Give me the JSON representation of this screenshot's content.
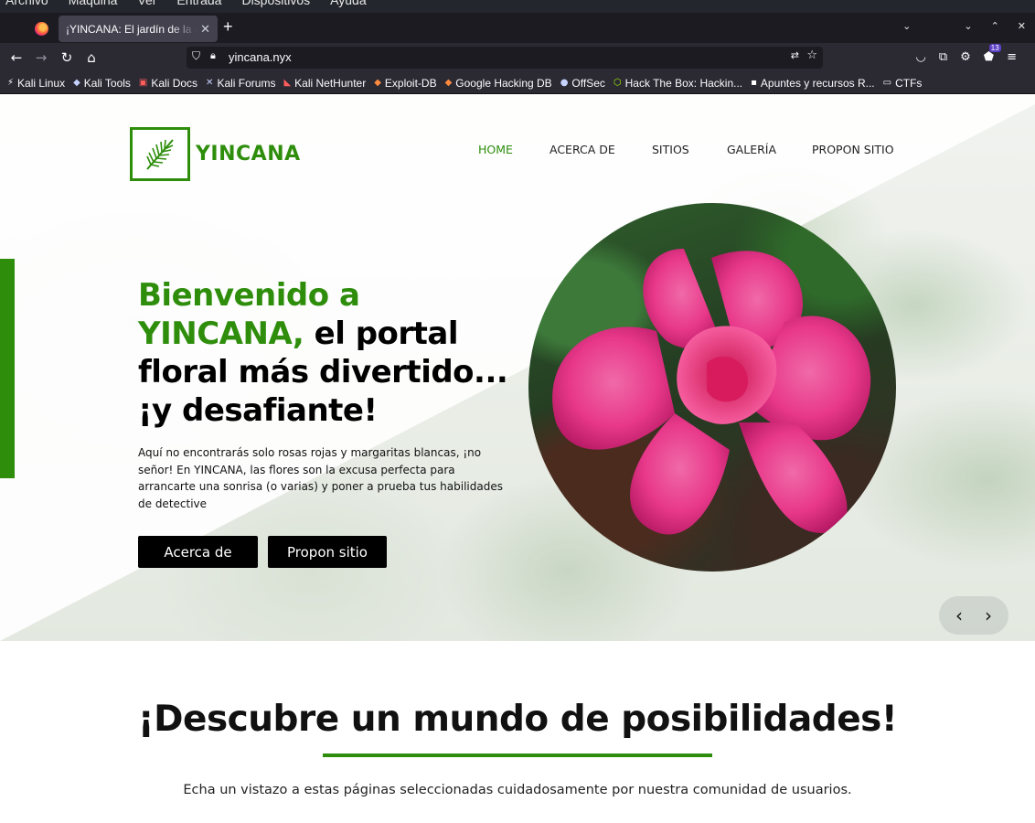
{
  "os_menu": [
    "Archivo",
    "Máquina",
    "Ver",
    "Entrada",
    "Dispositivos",
    "Ayuda"
  ],
  "browser": {
    "tab_title": "¡YINCANA: El jardín de la risa",
    "tab_close": "✕",
    "new_tab": "+",
    "url": "yincana.nyx",
    "extension_badge": "13",
    "bookmarks": [
      {
        "label": "Kali Linux",
        "icon": "kali-dragon-icon"
      },
      {
        "label": "Kali Tools",
        "icon": "kali-tools-icon"
      },
      {
        "label": "Kali Docs",
        "icon": "kali-docs-icon"
      },
      {
        "label": "Kali Forums",
        "icon": "kali-forums-icon"
      },
      {
        "label": "Kali NetHunter",
        "icon": "nethunter-icon"
      },
      {
        "label": "Exploit-DB",
        "icon": "exploit-db-icon"
      },
      {
        "label": "Google Hacking DB",
        "icon": "ghdb-icon"
      },
      {
        "label": "OffSec",
        "icon": "offsec-icon"
      },
      {
        "label": "Hack The Box: Hackin...",
        "icon": "htb-cube-icon"
      },
      {
        "label": "Apuntes y recursos R...",
        "icon": "terminal-icon"
      },
      {
        "label": "CTFs",
        "icon": "folder-icon"
      }
    ]
  },
  "site": {
    "logo_text": "YINCANA",
    "nav": [
      "HOME",
      "ACERCA DE",
      "SITIOS",
      "GALERÍA",
      "PROPON SITIO"
    ],
    "hero": {
      "title_green": "Bienvenido a YINCANA,",
      "title_black": " el portal floral más divertido... ¡y desafiante!",
      "paragraph": "Aquí no encontrarás solo rosas rojas y margaritas blancas, ¡no señor! En YINCANA, las flores son la excusa perfecta para arrancarte una sonrisa (o varias) y poner a prueba tus habilidades de detective",
      "button_about": "Acerca de",
      "button_propose": "Propon sitio",
      "prev": "‹",
      "next": "›"
    },
    "discover": {
      "title": "¡Descubre un mundo de posibilidades!",
      "text": "Echa un vistazo a estas páginas seleccionadas cuidadosamente por nuestra comunidad de usuarios."
    }
  },
  "colors": {
    "brand_green": "#2e8e0c",
    "button_black": "#000000",
    "browser_chrome": "#2b2a33"
  }
}
